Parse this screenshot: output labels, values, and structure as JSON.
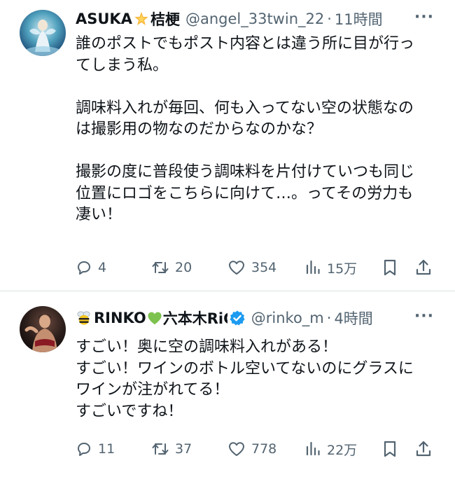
{
  "tweets": [
    {
      "name_prefix": "ASUKA",
      "name_suffix": "桔梗",
      "handle": "@angel_33twin_22",
      "time": "11時間",
      "more": "···",
      "lines": [
        "誰のポストでもポスト内容とは違う所に目が行っ",
        "てしまう私。",
        "",
        "調味料入れが毎回、何も入ってない空の状態なの",
        "は撮影用の物なのだからなのかな？",
        "",
        "撮影の度に普段使う調味料を片付けていつも同じ",
        "位置にロゴをこちらに向けて…。ってその労力も",
        "凄い！"
      ],
      "counts": {
        "reply": "4",
        "retweet": "20",
        "like": "354",
        "views": "15万"
      }
    },
    {
      "name_prefix": "RINKO",
      "name_suffix": "六本木RiC",
      "handle": "@rinko_m",
      "time": "4時間",
      "more": "···",
      "lines": [
        "すごい！奥に空の調味料入れがある！",
        "すごい！ワインのボトル空いてないのにグラスに",
        "ワインが注がれてる！",
        "すごいですね！"
      ],
      "counts": {
        "reply": "11",
        "retweet": "37",
        "like": "778",
        "views": "22万"
      }
    }
  ],
  "icons": {
    "star": "sparkle-star-emoji",
    "bee": "bee-emoji",
    "heart": "green-heart-emoji",
    "verified": "verified-badge-icon",
    "reply": "reply-icon",
    "retweet": "retweet-icon",
    "like": "like-icon",
    "views": "views-icon",
    "bookmark": "bookmark-icon",
    "share": "share-icon"
  },
  "colors": {
    "text": "#0f1419",
    "secondary": "#536471",
    "verified": "#1d9bf0",
    "divider": "#eff3f4"
  }
}
